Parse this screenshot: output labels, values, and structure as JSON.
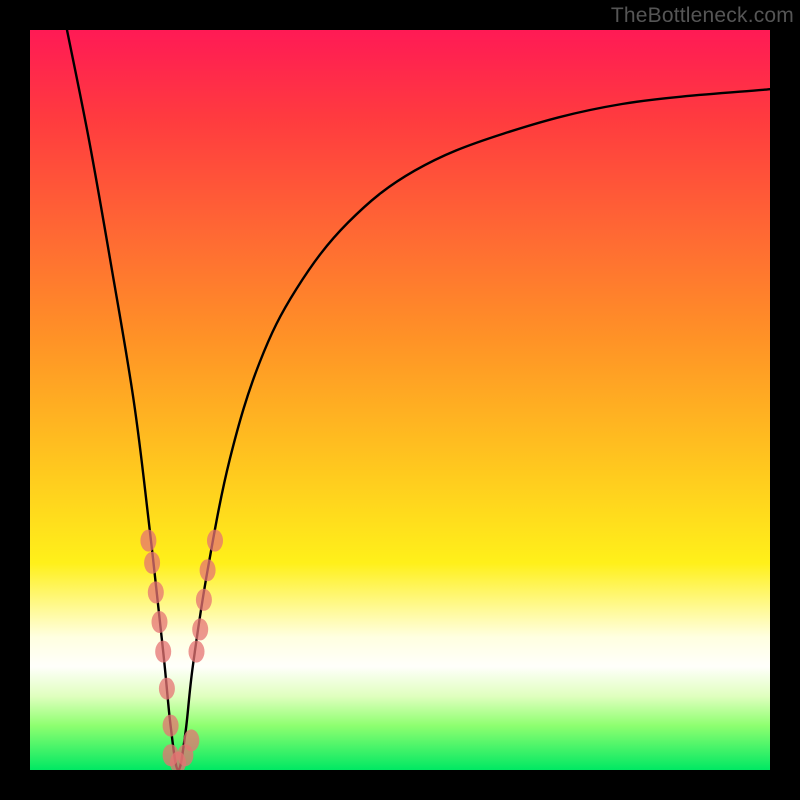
{
  "watermark": "TheBottleneck.com",
  "chart_data": {
    "type": "line",
    "title": "",
    "xlabel": "",
    "ylabel": "",
    "xlim": [
      0,
      100
    ],
    "ylim": [
      0,
      100
    ],
    "series": [
      {
        "name": "bottleneck-curve",
        "x_minimum": 20,
        "x": [
          5,
          8,
          11,
          14,
          16,
          18,
          19,
          20,
          21,
          22,
          24,
          27,
          31,
          36,
          43,
          52,
          64,
          80,
          100
        ],
        "values": [
          100,
          85,
          68,
          50,
          34,
          16,
          6,
          0,
          5,
          14,
          27,
          42,
          55,
          65,
          74,
          81,
          86,
          90,
          92
        ]
      }
    ],
    "marker_clusters": [
      {
        "name": "left-arm-markers",
        "points": [
          {
            "x": 16.0,
            "y": 31
          },
          {
            "x": 16.5,
            "y": 28
          },
          {
            "x": 17.0,
            "y": 24
          },
          {
            "x": 17.5,
            "y": 20
          },
          {
            "x": 18.0,
            "y": 16
          },
          {
            "x": 18.5,
            "y": 11
          },
          {
            "x": 19.0,
            "y": 6
          }
        ]
      },
      {
        "name": "right-arm-markers",
        "points": [
          {
            "x": 22.5,
            "y": 16
          },
          {
            "x": 23.0,
            "y": 19
          },
          {
            "x": 23.5,
            "y": 23
          },
          {
            "x": 24.0,
            "y": 27
          },
          {
            "x": 25.0,
            "y": 31
          }
        ]
      },
      {
        "name": "valley-floor-markers",
        "points": [
          {
            "x": 19.0,
            "y": 2
          },
          {
            "x": 20.0,
            "y": 1
          },
          {
            "x": 21.0,
            "y": 2
          },
          {
            "x": 21.8,
            "y": 4
          }
        ]
      }
    ],
    "gradient_meaning": "vertical: red (high bottleneck) at top → green (no bottleneck) at bottom"
  }
}
